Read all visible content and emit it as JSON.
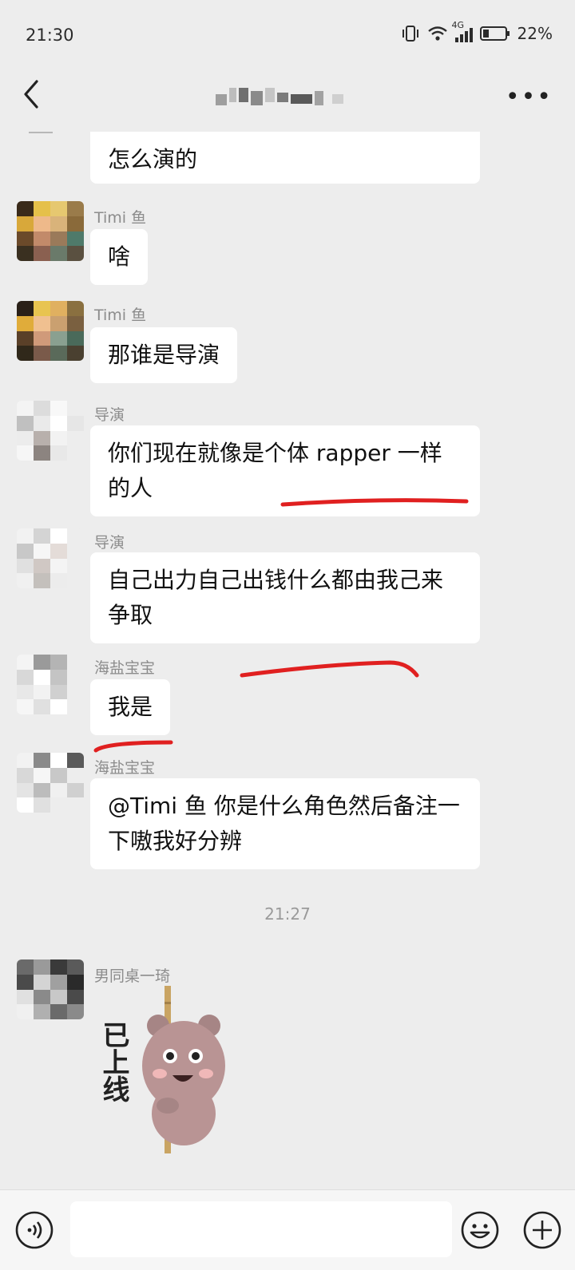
{
  "status_bar": {
    "time": "21:30",
    "network": "4G",
    "battery": "22%"
  },
  "header": {
    "title_obscured": true
  },
  "messages": [
    {
      "text_line": "怎么演的"
    },
    {
      "sender": "Timi 鱼",
      "text": "啥"
    },
    {
      "sender": "Timi 鱼",
      "text": "那谁是导演"
    },
    {
      "sender": "导演",
      "text": "你们现在就像是个体 rapper 一样的人"
    },
    {
      "sender": "导演",
      "text": "自己出力自己出钱什么都由我己来争取"
    },
    {
      "sender": "海盐宝宝",
      "text": "我是"
    },
    {
      "sender": "海盐宝宝",
      "text": "@Timi 鱼  你是什么角色然后备注一下嗷我好分辨"
    }
  ],
  "timestamp": "21:27",
  "last_message": {
    "sender": "男同桌一琦",
    "sticker_text": "已上线"
  },
  "colors": {
    "background": "#ededed",
    "bubble": "#ffffff",
    "underline": "#e02020"
  }
}
